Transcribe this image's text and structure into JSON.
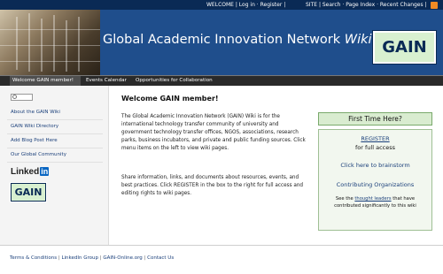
{
  "topbar": {
    "welcome_text": "WELCOME | Log in · Register |",
    "site_text": "SITE | Search · Page Index · Recent Changes |"
  },
  "header": {
    "title_main": "Global Academic Innovation Network",
    "title_wiki": "Wiki",
    "logo_text": "GAIN"
  },
  "tabs": [
    {
      "label": "Welcome GAIN member!",
      "active": true
    },
    {
      "label": "Events Calendar",
      "active": false
    },
    {
      "label": "Opportunities for Collaboration",
      "active": false
    }
  ],
  "sidebar": {
    "search_placeholder": "",
    "links": [
      {
        "label": "About the GAIN Wiki"
      },
      {
        "label": "GAIN Wiki Directory"
      },
      {
        "label": "Add Blog Post Here"
      },
      {
        "label": "Our Global Community"
      }
    ],
    "linkedin_text": "Linked",
    "linkedin_in": "in",
    "gain_badge": "GAIN"
  },
  "main": {
    "heading": "Welcome GAIN member!",
    "para1": "The Global Academic Innovation Network (GAIN) Wiki is for the international technology transfer community of university and government technology transfer offices, NGOS, associations, research parks, business incubators, and private and public funding sources. Click menu items on the left to view wiki pages.",
    "para2": "Share information, links, and documents about resources, events, and best practices.  Click REGISTER in the box to the right for full access and editing rights to wiki pages."
  },
  "right_box": {
    "first_time": "First Time Here?",
    "register": "REGISTER",
    "full_access": "for full access",
    "brainstorm": "Click here to brainstorm",
    "contributing": "Contributing Organizations",
    "note_prefix": "See the ",
    "note_link": "thought leaders",
    "note_suffix": " that have contributed significantly to this wiki"
  },
  "footer": {
    "links": [
      "Terms & Conditions",
      "LinkedIn Group",
      "GAIN-Online.org",
      "Contact Us"
    ],
    "separator": " | "
  }
}
